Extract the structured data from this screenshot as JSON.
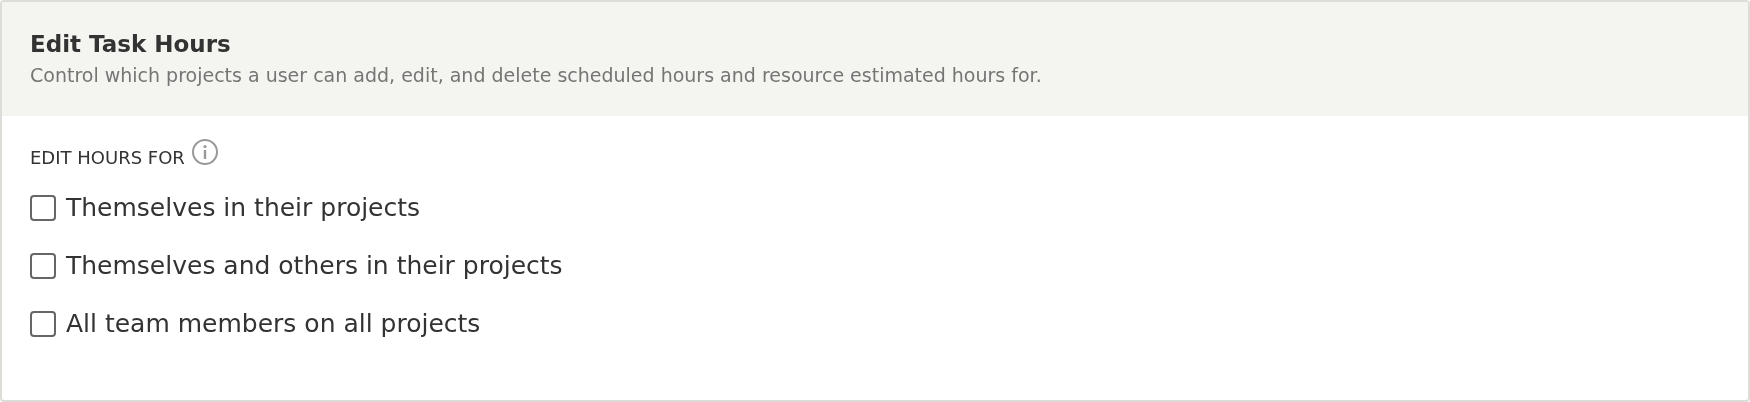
{
  "panel": {
    "title": "Edit Task Hours",
    "description": "Control which projects a user can add, edit, and delete scheduled hours and resource estimated hours for."
  },
  "section": {
    "label": "EDIT HOURS FOR"
  },
  "options": [
    {
      "label": "Themselves in their projects",
      "checked": false
    },
    {
      "label": "Themselves and others in their projects",
      "checked": false
    },
    {
      "label": "All team members on all projects",
      "checked": false
    }
  ]
}
